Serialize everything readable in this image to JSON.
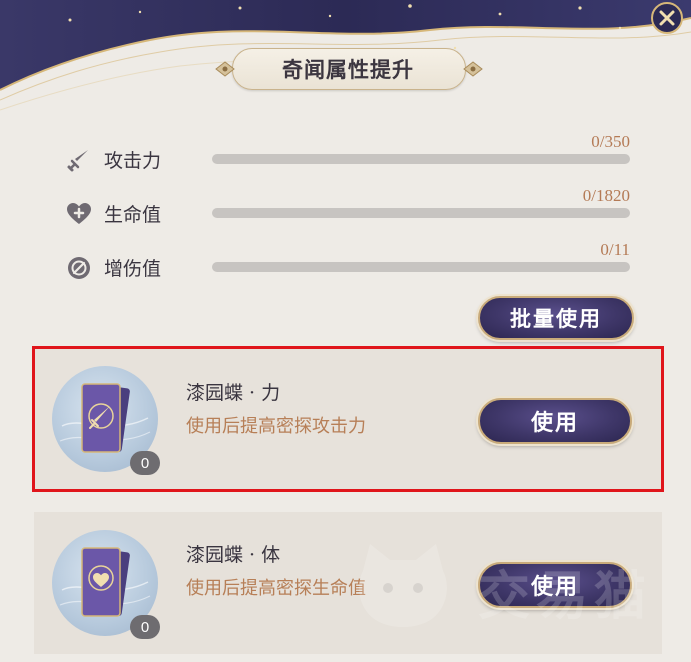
{
  "panel": {
    "title": "奇闻属性提升"
  },
  "stats": [
    {
      "label": "攻击力",
      "value": "0/350",
      "icon": "sword-icon",
      "progress": 0
    },
    {
      "label": "生命值",
      "value": "0/1820",
      "icon": "heart-icon",
      "progress": 0
    },
    {
      "label": "增伤值",
      "value": "0/11",
      "icon": "damage-boost-icon",
      "progress": 0
    }
  ],
  "bulk_use_label": "批量使用",
  "items": [
    {
      "name": "漆园蝶 · 力",
      "desc": "使用后提高密探攻击力",
      "count": "0",
      "button": "使用",
      "icon": "sword-card-icon",
      "selected": true
    },
    {
      "name": "漆园蝶 · 体",
      "desc": "使用后提高密探生命值",
      "count": "0",
      "button": "使用",
      "icon": "heart-card-icon",
      "selected": false
    }
  ],
  "watermark": {
    "text": "交易猫"
  },
  "colors": {
    "accent": "#b47a55",
    "button": "#3f3769",
    "highlight": "#e0151b"
  }
}
